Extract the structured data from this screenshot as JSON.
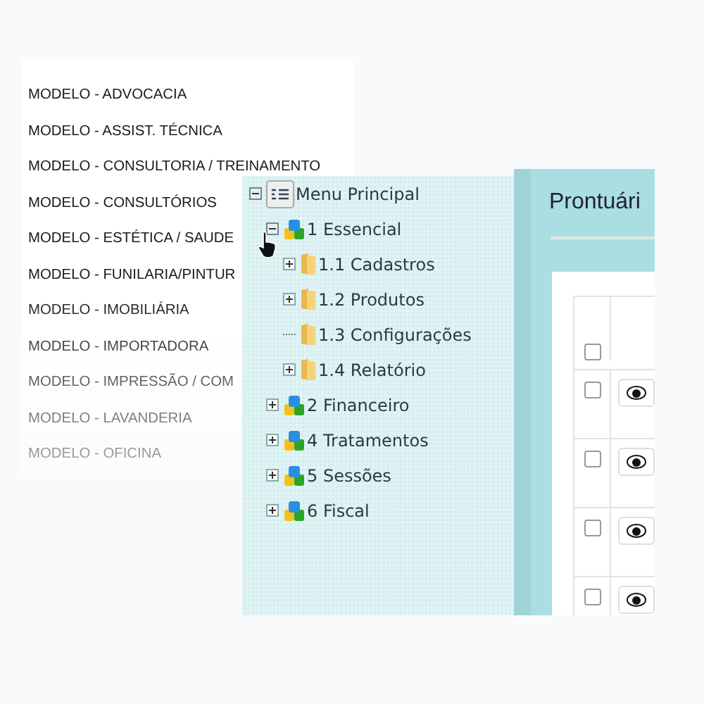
{
  "model_list": {
    "items": [
      "MODELO - ADVOCACIA",
      "MODELO - ASSIST. TÉCNICA",
      "MODELO - CONSULTORIA / TREINAMENTO",
      "MODELO - CONSULTÓRIOS",
      "MODELO - ESTÉTICA / SAUDE",
      "MODELO - FUNILARIA/PINTUR",
      "MODELO - IMOBILIÁRIA",
      "MODELO - IMPORTADORA",
      "MODELO - IMPRESSÃO / COM",
      "MODELO - LAVANDERIA",
      "MODELO - OFICINA"
    ]
  },
  "tree": {
    "items": [
      {
        "label": "Menu Principal",
        "kind": "menu",
        "expanded": true,
        "children": [
          {
            "label": "1 Essencial",
            "kind": "module",
            "expanded": true,
            "children": [
              {
                "label": "1.1 Cadastros",
                "kind": "folder",
                "expanded": false
              },
              {
                "label": "1.2 Produtos",
                "kind": "folder",
                "expanded": false
              },
              {
                "label": "1.3 Configurações",
                "kind": "leaf"
              },
              {
                "label": "1.4 Relatório",
                "kind": "folder",
                "expanded": false
              }
            ]
          },
          {
            "label": "2 Financeiro",
            "kind": "module",
            "expanded": false
          },
          {
            "label": "4 Tratamentos",
            "kind": "module",
            "expanded": false
          },
          {
            "label": "5 Sessões",
            "kind": "module",
            "expanded": false
          },
          {
            "label": "6 Fiscal",
            "kind": "module",
            "expanded": false
          }
        ]
      }
    ]
  },
  "record_panel": {
    "title": "Prontuári",
    "header": {
      "checked": false
    },
    "rows": [
      {
        "checked": false
      },
      {
        "checked": false
      },
      {
        "checked": false
      },
      {
        "checked": false
      }
    ]
  }
}
